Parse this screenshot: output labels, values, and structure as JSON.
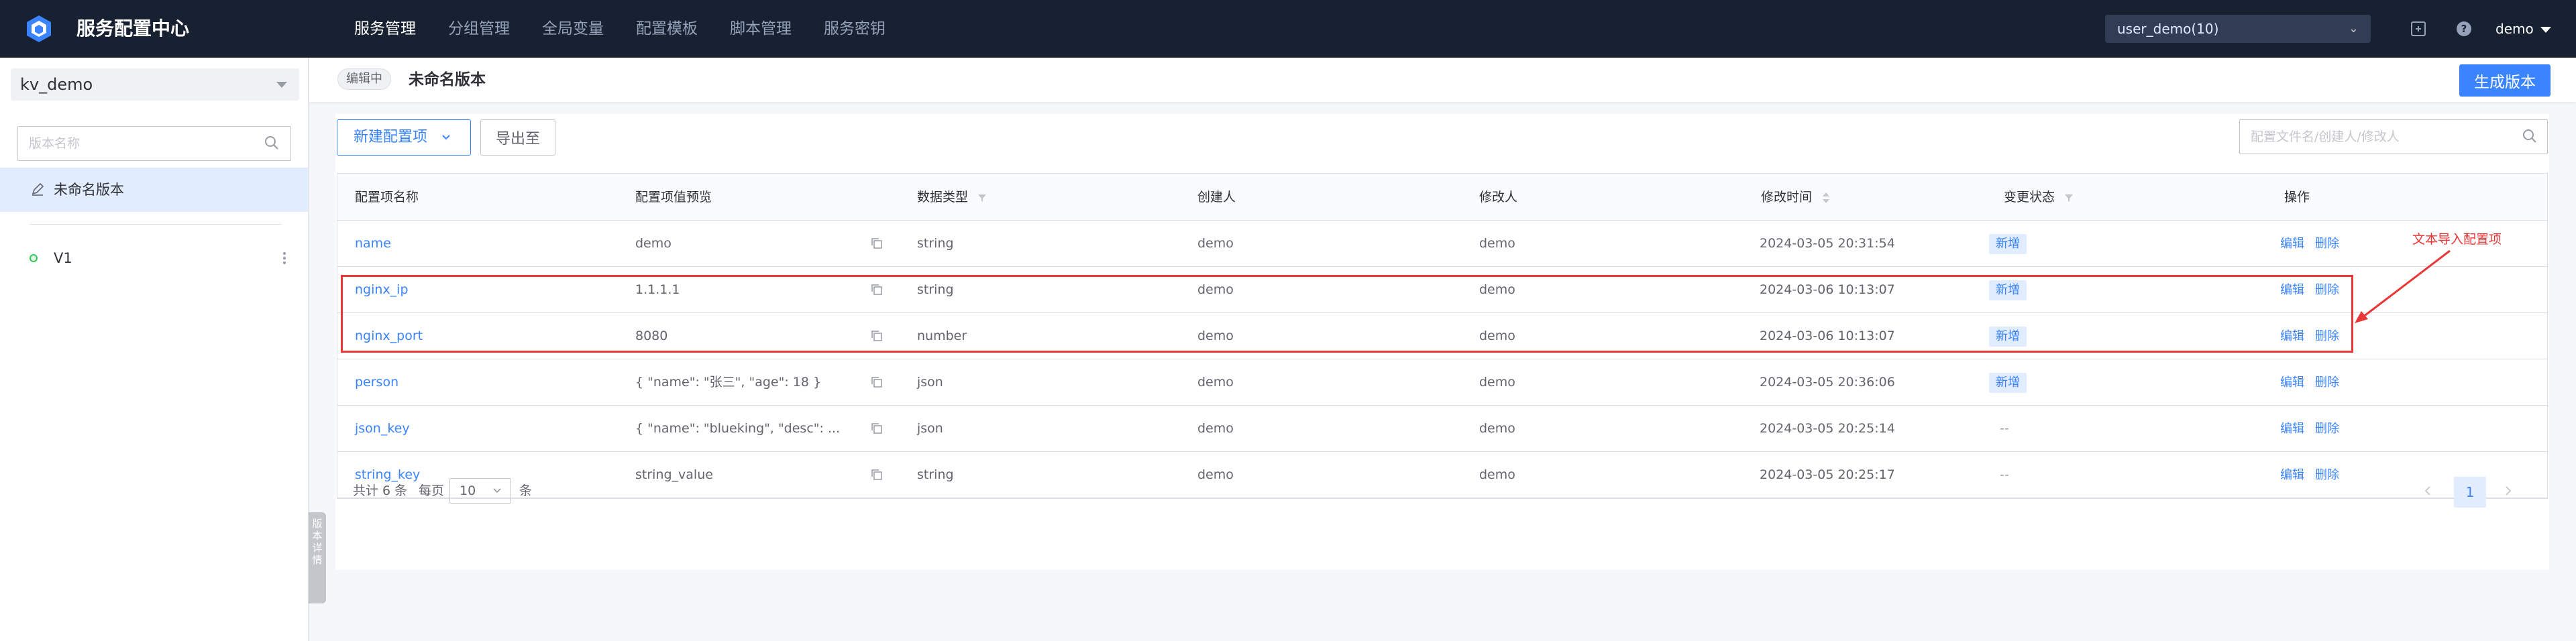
{
  "app": {
    "title": "服务配置中心"
  },
  "nav": {
    "items": [
      {
        "label": "服务管理",
        "active": true
      },
      {
        "label": "分组管理",
        "active": false
      },
      {
        "label": "全局变量",
        "active": false
      },
      {
        "label": "配置模板",
        "active": false
      },
      {
        "label": "脚本管理",
        "active": false
      },
      {
        "label": "服务密钥",
        "active": false
      }
    ]
  },
  "header_right": {
    "business": "user_demo(10)",
    "user": "demo",
    "icons": [
      "link-icon",
      "help-icon"
    ]
  },
  "sidebar": {
    "service": "kv_demo",
    "search_placeholder": "版本名称",
    "versions": [
      {
        "label": "未命名版本",
        "active": true,
        "icon": "edit-icon"
      },
      {
        "label": "V1",
        "active": false,
        "icon": "status-dot-icon"
      }
    ],
    "collapse_label": "版本详情"
  },
  "main_header": {
    "status": "编辑中",
    "title": "未命名版本",
    "generate_label": "生成版本"
  },
  "toolbar": {
    "new_label": "新建配置项",
    "export_label": "导出至",
    "search_placeholder": "配置文件名/创建人/修改人"
  },
  "table": {
    "headers": {
      "name": "配置项名称",
      "preview": "配置项值预览",
      "type": "数据类型",
      "creator": "创建人",
      "modifier": "修改人",
      "mtime": "修改时间",
      "status": "变更状态",
      "actions": "操作"
    },
    "rows": [
      {
        "name": "name",
        "preview": "demo",
        "type": "string",
        "creator": "demo",
        "modifier": "demo",
        "mtime": "2024-03-05 20:31:54",
        "status": "新增",
        "edit": "编辑",
        "delete": "删除"
      },
      {
        "name": "nginx_ip",
        "preview": "1.1.1.1",
        "type": "string",
        "creator": "demo",
        "modifier": "demo",
        "mtime": "2024-03-06 10:13:07",
        "status": "新增",
        "edit": "编辑",
        "delete": "删除"
      },
      {
        "name": "nginx_port",
        "preview": "8080",
        "type": "number",
        "creator": "demo",
        "modifier": "demo",
        "mtime": "2024-03-06 10:13:07",
        "status": "新增",
        "edit": "编辑",
        "delete": "删除"
      },
      {
        "name": "person",
        "preview": "{ \"name\": \"张三\", \"age\": 18 }",
        "type": "json",
        "creator": "demo",
        "modifier": "demo",
        "mtime": "2024-03-05 20:36:06",
        "status": "新增",
        "edit": "编辑",
        "delete": "删除"
      },
      {
        "name": "json_key",
        "preview": "{ \"name\": \"blueking\", \"desc\": ...",
        "type": "json",
        "creator": "demo",
        "modifier": "demo",
        "mtime": "2024-03-05 20:25:14",
        "status": "--",
        "edit": "编辑",
        "delete": "删除"
      },
      {
        "name": "string_key",
        "preview": "string_value",
        "type": "string",
        "creator": "demo",
        "modifier": "demo",
        "mtime": "2024-03-05 20:25:17",
        "status": "--",
        "edit": "编辑",
        "delete": "删除"
      }
    ]
  },
  "pagination": {
    "total": "共计 6 条",
    "per_page_label": "每页",
    "page_size": "10",
    "per_page_unit": "条",
    "current": "1"
  },
  "annotation": {
    "text": "文本导入配置项",
    "color": "#ea3636"
  },
  "colors": {
    "primary": "#3a84ff",
    "topbar": "#182132",
    "active_bg": "#e1ecff",
    "success": "#2dcb56"
  }
}
